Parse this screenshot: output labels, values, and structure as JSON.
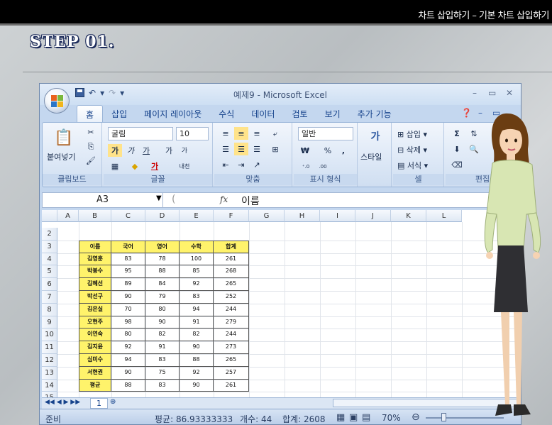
{
  "header": {
    "title": "차트 삽입하기 – 기본 차트 삽입하기"
  },
  "step": {
    "label": "STEP 01."
  },
  "excel": {
    "window_title": "예제9 - Microsoft Excel",
    "qat": {
      "undo": "↶",
      "redo": "↷",
      "dropdown": "▾"
    },
    "tabs": [
      "홈",
      "삽입",
      "페이지 레이아웃",
      "수식",
      "데이터",
      "검토",
      "보기",
      "추가 기능"
    ],
    "ribbon": {
      "clipboard": {
        "paste": "붙여넣기",
        "label": "클립보드"
      },
      "font": {
        "name": "굴림",
        "size": "10",
        "label": "글꼴",
        "bold": "가",
        "italic": "가",
        "underline": "가",
        "grow": "가",
        "shrink": "가",
        "phonetic": "내천"
      },
      "alignment": {
        "label": "맞춤"
      },
      "number": {
        "format": "일반",
        "currency": "₩",
        "percent": "%",
        "comma": ",",
        "inc": "+.0 .00",
        "dec": ".00 +.0",
        "label": "표시 형식"
      },
      "styles": {
        "label": "스타일"
      },
      "cells": {
        "insert": "삽입",
        "delete": "삭제",
        "format": "서식",
        "label": "셀"
      },
      "editing": {
        "sum": "Σ",
        "label": "편집"
      }
    },
    "formula_bar": {
      "name_box": "A3",
      "fx": "fx",
      "value": "이름"
    },
    "columns": [
      "A",
      "B",
      "C",
      "D",
      "E",
      "F",
      "G",
      "H",
      "I",
      "J",
      "K",
      "L"
    ],
    "rows": [
      "2",
      "3",
      "4",
      "5",
      "6",
      "7",
      "8",
      "9",
      "10",
      "11",
      "12",
      "13",
      "14",
      "15"
    ],
    "table": {
      "headers": [
        "이름",
        "국어",
        "영어",
        "수학",
        "합계"
      ],
      "rows": [
        [
          "김영훈",
          "83",
          "78",
          "100",
          "261"
        ],
        [
          "박봉수",
          "95",
          "88",
          "85",
          "268"
        ],
        [
          "김혜선",
          "89",
          "84",
          "92",
          "265"
        ],
        [
          "박선구",
          "90",
          "79",
          "83",
          "252"
        ],
        [
          "김은실",
          "70",
          "80",
          "94",
          "244"
        ],
        [
          "오현주",
          "98",
          "90",
          "91",
          "279"
        ],
        [
          "이연숙",
          "80",
          "82",
          "82",
          "244"
        ],
        [
          "김지윤",
          "92",
          "91",
          "90",
          "273"
        ],
        [
          "심미수",
          "94",
          "83",
          "88",
          "265"
        ],
        [
          "서현권",
          "90",
          "75",
          "92",
          "257"
        ],
        [
          "평균",
          "88",
          "83",
          "90",
          "261"
        ]
      ]
    },
    "sheet_tab": "1",
    "status": {
      "ready": "준비",
      "average": "평균: 86.93333333",
      "count": "개수: 44",
      "sum": "합계: 2608",
      "zoom": "70%"
    }
  },
  "colors": {
    "header_fill": "#fff36b",
    "excel_blue": "#c4d7ef",
    "topbar": "#000000"
  }
}
